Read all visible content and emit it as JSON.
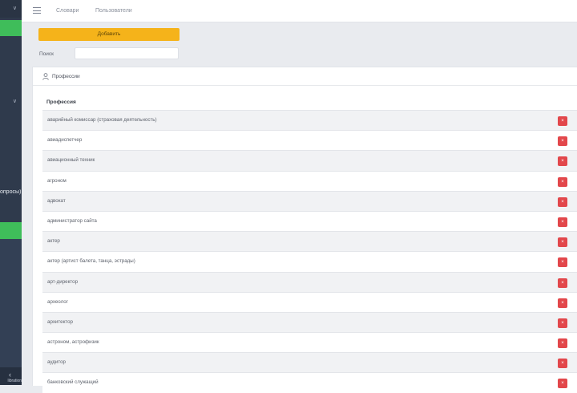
{
  "sidebar": {
    "partial_label": "опросы)",
    "collapse_glyph": "‹",
    "bottom_text": "libration"
  },
  "header": {
    "nav": [
      "Словари",
      "Пользователи"
    ]
  },
  "controls": {
    "add_label": "Добавить",
    "search_label": "Поиск",
    "search_value": "",
    "search_placeholder": ""
  },
  "panel": {
    "title": "Профессии",
    "column_header": "Профессия",
    "delete_glyph": "×",
    "rows": [
      "аварийный комиссар (страховая деятельность)",
      "авиадиспетчер",
      "авиационный техник",
      "агроном",
      "адвокат",
      "администратор сайта",
      "актер",
      "актер (артист балета, танца, эстрады)",
      "арт-директор",
      "археолог",
      "архитектор",
      "астроном, астрофизик",
      "аудитор",
      "банковский служащий"
    ]
  },
  "colors": {
    "sidebar": "#2f3a4c",
    "sidebar_active": "#3fbd5a",
    "add_button": "#f5b31a",
    "delete_button": "#e2474b",
    "background": "#e9ebef"
  }
}
